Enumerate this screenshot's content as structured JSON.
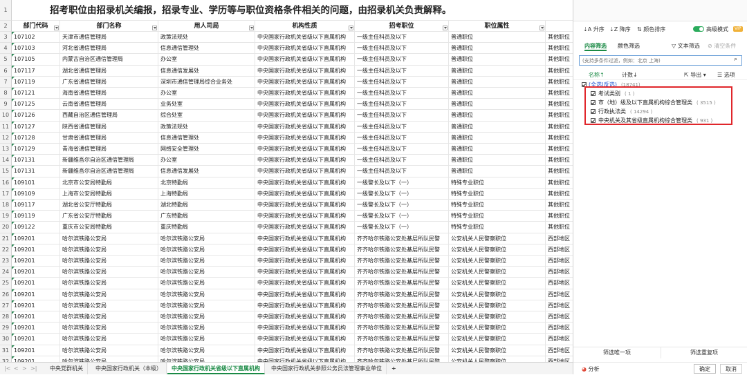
{
  "title": "招考职位由招录机关编报，招录专业、学历等与职位资格条件相关的问题，由招录机关负责解释。",
  "columns": [
    "部门代码",
    "部门名称",
    "用人司局",
    "机构性质",
    "招考职位",
    "职位属性"
  ],
  "row_numbers": [
    "1",
    "2",
    "3",
    "4",
    "5",
    "6",
    "7",
    "8",
    "9",
    "10",
    "11",
    "12",
    "13",
    "14",
    "15",
    "16",
    "17",
    "18",
    "19",
    "20",
    "21",
    "22",
    "23",
    "24",
    "25",
    "26",
    "27",
    "28",
    "29",
    "30",
    "31",
    "32"
  ],
  "rows": [
    [
      "107102",
      "天津市通信管理局",
      "政策法规处",
      "中央国家行政机关省级以下直属机构",
      "一级主任科员及以下",
      "普通职位",
      "其他职位"
    ],
    [
      "107103",
      "河北省通信管理局",
      "信息通信管理处",
      "中央国家行政机关省级以下直属机构",
      "一级主任科员及以下",
      "普通职位",
      "其他职位"
    ],
    [
      "107105",
      "内蒙古自治区通信管理局",
      "办公室",
      "中央国家行政机关省级以下直属机构",
      "一级主任科员及以下",
      "普通职位",
      "其他职位"
    ],
    [
      "107117",
      "湖北省通信管理局",
      "信息通信发展处",
      "中央国家行政机关省级以下直属机构",
      "一级主任科员及以下",
      "普通职位",
      "其他职位"
    ],
    [
      "107119",
      "广东省通信管理局",
      "深圳市通信管理局综合业务处",
      "中央国家行政机关省级以下直属机构",
      "一级主任科员及以下",
      "普通职位",
      "其他职位"
    ],
    [
      "107121",
      "海南省通信管理局",
      "办公室",
      "中央国家行政机关省级以下直属机构",
      "一级主任科员及以下",
      "普通职位",
      "其他职位"
    ],
    [
      "107125",
      "云南省通信管理局",
      "业务处室",
      "中央国家行政机关省级以下直属机构",
      "一级主任科员及以下",
      "普通职位",
      "其他职位"
    ],
    [
      "107126",
      "西藏自治区通信管理局",
      "综合处室",
      "中央国家行政机关省级以下直属机构",
      "一级主任科员及以下",
      "普通职位",
      "其他职位"
    ],
    [
      "107127",
      "陕西省通信管理局",
      "政策法规处",
      "中央国家行政机关省级以下直属机构",
      "一级主任科员及以下",
      "普通职位",
      "其他职位"
    ],
    [
      "107128",
      "甘肃省通信管理局",
      "信息通信管理处",
      "中央国家行政机关省级以下直属机构",
      "一级主任科员及以下",
      "普通职位",
      "其他职位"
    ],
    [
      "107129",
      "青海省通信管理局",
      "网络安全管理处",
      "中央国家行政机关省级以下直属机构",
      "一级主任科员及以下",
      "普通职位",
      "其他职位"
    ],
    [
      "107131",
      "新疆维吾尔自治区通信管理局",
      "办公室",
      "中央国家行政机关省级以下直属机构",
      "一级主任科员及以下",
      "普通职位",
      "其他职位"
    ],
    [
      "107131",
      "新疆维吾尔自治区通信管理局",
      "信息通信发展处",
      "中央国家行政机关省级以下直属机构",
      "一级主任科员及以下",
      "普通职位",
      "其他职位"
    ],
    [
      "109101",
      "北京市公安局特勤局",
      "北京特勤局",
      "中央国家行政机关省级以下直属机构",
      "一级警长及以下（一）",
      "特殊专业职位",
      "其他职位"
    ],
    [
      "109109",
      "上海市公安局特勤局",
      "上海特勤局",
      "中央国家行政机关省级以下直属机构",
      "一级警长及以下（一）",
      "特殊专业职位",
      "其他职位"
    ],
    [
      "109117",
      "湖北省公安厅特勤局",
      "湖北特勤局",
      "中央国家行政机关省级以下直属机构",
      "一级警长及以下（一）",
      "特殊专业职位",
      "其他职位"
    ],
    [
      "109119",
      "广东省公安厅特勤局",
      "广东特勤局",
      "中央国家行政机关省级以下直属机构",
      "一级警长及以下（一）",
      "特殊专业职位",
      "其他职位"
    ],
    [
      "109122",
      "重庆市公安局特勤局",
      "重庆特勤局",
      "中央国家行政机关省级以下直属机构",
      "一级警长及以下（一）",
      "特殊专业职位",
      "其他职位"
    ],
    [
      "109201",
      "哈尔滨铁路公安局",
      "哈尔滨铁路公安局",
      "中央国家行政机关省级以下直属机构",
      "齐齐哈尔铁路公安处基层所队民警",
      "公安机关人民警察职位",
      "西部地区"
    ],
    [
      "109201",
      "哈尔滨铁路公安局",
      "哈尔滨铁路公安局",
      "中央国家行政机关省级以下直属机构",
      "齐齐哈尔铁路公安处基层所队民警",
      "公安机关人民警察职位",
      "西部地区"
    ],
    [
      "109201",
      "哈尔滨铁路公安局",
      "哈尔滨铁路公安局",
      "中央国家行政机关省级以下直属机构",
      "齐齐哈尔铁路公安处基层所队民警",
      "公安机关人民警察职位",
      "西部地区"
    ],
    [
      "109201",
      "哈尔滨铁路公安局",
      "哈尔滨铁路公安局",
      "中央国家行政机关省级以下直属机构",
      "齐齐哈尔铁路公安处基层所队民警",
      "公安机关人民警察职位",
      "西部地区"
    ],
    [
      "109201",
      "哈尔滨铁路公安局",
      "哈尔滨铁路公安局",
      "中央国家行政机关省级以下直属机构",
      "齐齐哈尔铁路公安处基层所队民警",
      "公安机关人民警察职位",
      "西部地区"
    ],
    [
      "109201",
      "哈尔滨铁路公安局",
      "哈尔滨铁路公安局",
      "中央国家行政机关省级以下直属机构",
      "齐齐哈尔铁路公安处基层所队民警",
      "公安机关人民警察职位",
      "西部地区"
    ],
    [
      "109201",
      "哈尔滨铁路公安局",
      "哈尔滨铁路公安局",
      "中央国家行政机关省级以下直属机构",
      "齐齐哈尔铁路公安处基层所队民警",
      "公安机关人民警察职位",
      "西部地区"
    ],
    [
      "109201",
      "哈尔滨铁路公安局",
      "哈尔滨铁路公安局",
      "中央国家行政机关省级以下直属机构",
      "齐齐哈尔铁路公安处基层所队民警",
      "公安机关人民警察职位",
      "西部地区"
    ],
    [
      "109201",
      "哈尔滨铁路公安局",
      "哈尔滨铁路公安局",
      "中央国家行政机关省级以下直属机构",
      "齐齐哈尔铁路公安处基层所队民警",
      "公安机关人民警察职位",
      "西部地区"
    ],
    [
      "109201",
      "哈尔滨铁路公安局",
      "哈尔滨铁路公安局",
      "中央国家行政机关省级以下直属机构",
      "齐齐哈尔铁路公安处基层所队民警",
      "公安机关人民警察职位",
      "西部地区"
    ],
    [
      "109201",
      "哈尔滨铁路公安局",
      "哈尔滨铁路公安局",
      "中央国家行政机关省级以下直属机构",
      "齐齐哈尔铁路公安处基层所队民警",
      "公安机关人民警察职位",
      "西部地区"
    ],
    [
      "109201",
      "哈尔滨铁路公安局",
      "哈尔滨铁路公安局",
      "中央国家行政机关省级以下直属机构",
      "齐齐哈尔铁路公安处基层所队民警",
      "公安机关人民警察职位",
      "西部地区"
    ]
  ],
  "sheet_tabs": {
    "nav": [
      "|<",
      "<",
      ">",
      ">|"
    ],
    "items": [
      "中央党群机关",
      "中央国家行政机关（本级）",
      "中央国家行政机关省级以下直属机构",
      "中央国家行政机关参照公务员法管理事业单位"
    ],
    "active_index": 2,
    "add": "+"
  },
  "panel": {
    "sort_asc": "升序",
    "sort_desc": "降序",
    "color_sort": "颜色排序",
    "advanced_mode": "高级模式",
    "vip": "VIP",
    "tab_content": "内容筛选",
    "tab_color": "颜色筛选",
    "text_filter": "文本筛选",
    "clear_filter": "清空条件",
    "search_placeholder": "(支持多条件过滤，例如：北京 上海)",
    "col_name": "名称↑",
    "col_count": "计数↓",
    "export": "导出",
    "options": "选项",
    "select_all": "(全选|反选)",
    "select_all_count": "(18741)",
    "items": [
      {
        "label": "考试类别",
        "count": "( 1 )"
      },
      {
        "label": "市（地）级及以下直属机构综合管理类",
        "count": "( 3515 )"
      },
      {
        "label": "行政执法类",
        "count": "( 14294 )"
      },
      {
        "label": "中央机关及其省级直属机构综合管理类",
        "count": "( 931 )"
      }
    ],
    "filter_unique": "筛选唯一项",
    "filter_dup": "筛选重复项",
    "analysis": "分析",
    "ok": "确定",
    "cancel": "取消"
  }
}
